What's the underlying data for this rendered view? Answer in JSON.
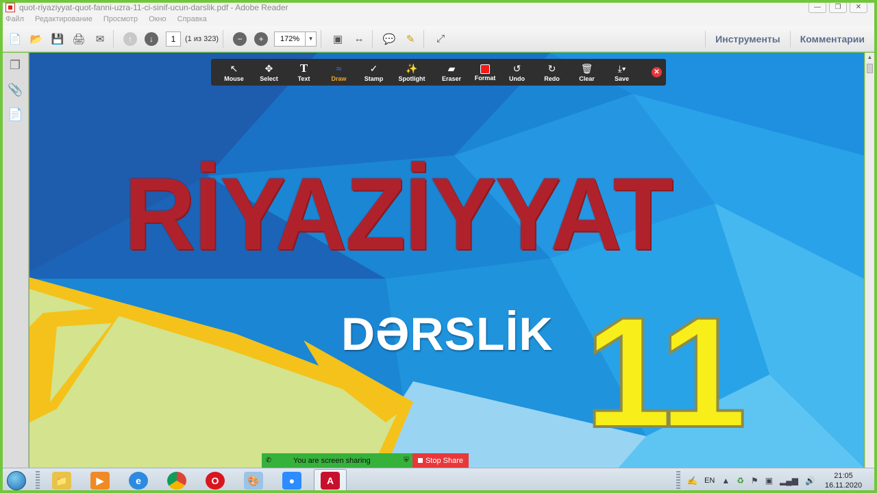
{
  "window": {
    "title": "quot-riyaziyyat-quot-fanni-uzra-11-ci-sinif-ucun-darslik.pdf - Adobe Reader"
  },
  "menu": [
    "Файл",
    "Редактирование",
    "Просмотр",
    "Окно",
    "Справка"
  ],
  "toolbar": {
    "page_value": "1",
    "page_count": "(1 из 323)",
    "zoom": "172%",
    "tools_label": "Инструменты",
    "comments_label": "Комментарии"
  },
  "annotation_toolbar": {
    "tools": [
      {
        "label": "Mouse",
        "icon": "cursor-icon"
      },
      {
        "label": "Select",
        "icon": "move-icon"
      },
      {
        "label": "Text",
        "icon": "text-icon"
      },
      {
        "label": "Draw",
        "icon": "draw-icon"
      },
      {
        "label": "Stamp",
        "icon": "check-icon"
      },
      {
        "label": "Spotlight",
        "icon": "wand-icon"
      },
      {
        "label": "Eraser",
        "icon": "eraser-icon"
      },
      {
        "label": "Format",
        "icon": "format-icon"
      },
      {
        "label": "Undo",
        "icon": "undo-icon"
      },
      {
        "label": "Redo",
        "icon": "redo-icon"
      },
      {
        "label": "Clear",
        "icon": "trash-icon"
      },
      {
        "label": "Save",
        "icon": "save-icon"
      }
    ],
    "active_tool": "Draw",
    "format_color": "#f41a1a"
  },
  "document": {
    "title": "RİYAZİYYAT",
    "subtitle": "DƏRSLİK",
    "grade": "11",
    "title_color": "#b0222b",
    "grade_color": "#f7ee1a"
  },
  "share_banner": {
    "message": "You are screen sharing",
    "stop_label": "Stop Share"
  },
  "taskbar": {
    "apps": [
      "file-explorer-icon",
      "media-player-icon",
      "internet-explorer-icon",
      "chrome-icon",
      "opera-icon",
      "paint-icon",
      "zoom-icon",
      "adobe-reader-icon"
    ],
    "language": "EN",
    "time": "21:05",
    "date": "16.11.2020"
  }
}
